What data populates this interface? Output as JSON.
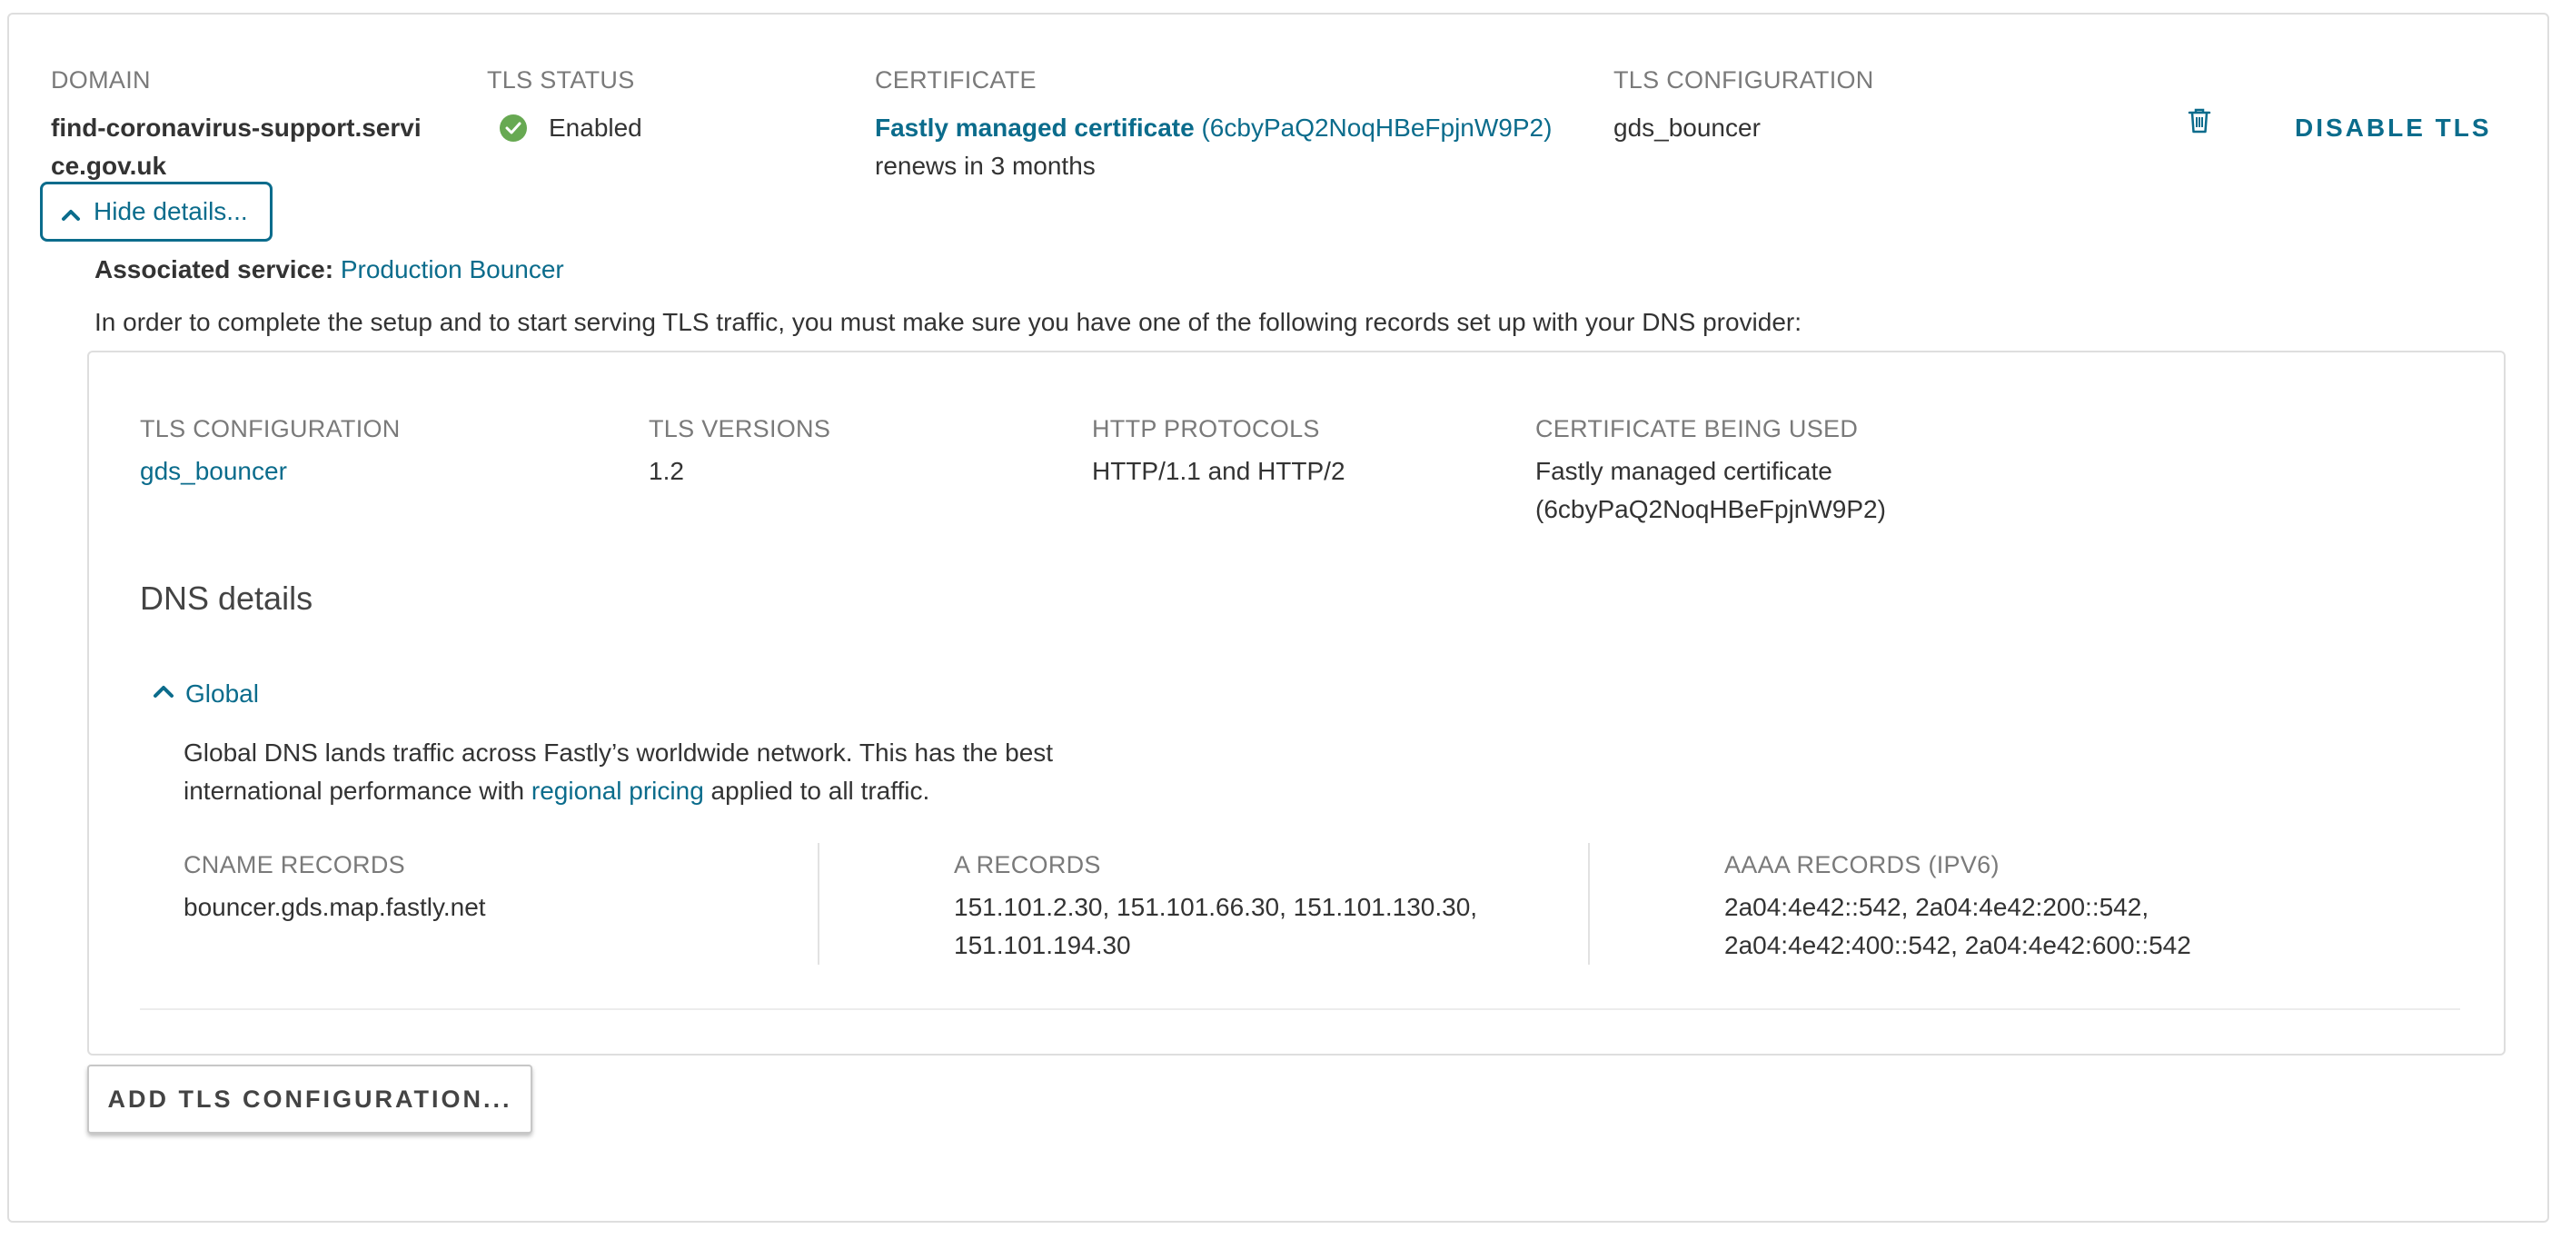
{
  "header": {
    "domain_label": "DOMAIN",
    "tls_status_label": "TLS STATUS",
    "certificate_label": "CERTIFICATE",
    "tls_config_label": "TLS CONFIGURATION"
  },
  "row": {
    "domain_line1": "find-coronavirus-support.servi",
    "domain_line2": "ce.gov.uk",
    "status": "Enabled",
    "certificate_name": "Fastly managed certificate",
    "certificate_id": "(6cbyPaQ2NoqHBeFpjnW9P2)",
    "renews": "renews in 3 months",
    "tls_config": "gds_bouncer",
    "disable_label": "DISABLE TLS",
    "icons": {
      "status": "check-circle-icon",
      "delete": "trash-icon"
    },
    "status_color": "#67a952"
  },
  "details": {
    "toggle_label": "Hide details...",
    "associated_label": "Associated service:",
    "associated_value": "Production Bouncer",
    "instructions": "In order to complete the setup and to start serving TLS traffic, you must make sure you have one of the following records set up with your DNS provider:"
  },
  "config": {
    "headers": {
      "tls_config": "TLS CONFIGURATION",
      "tls_versions": "TLS VERSIONS",
      "http_protocols": "HTTP PROTOCOLS",
      "certificate": "CERTIFICATE BEING USED"
    },
    "tls_config": "gds_bouncer",
    "tls_versions": "1.2",
    "http_protocols": "HTTP/1.1 and HTTP/2",
    "certificate_line1": "Fastly managed certificate",
    "certificate_line2": "(6cbyPaQ2NoqHBeFpjnW9P2)"
  },
  "dns": {
    "title": "DNS details",
    "region": "Global",
    "desc_line1": "Global DNS lands traffic across Fastly’s worldwide network. This has the best",
    "desc_line2_pre": "international performance with ",
    "desc_link": "regional pricing",
    "desc_line2_post": " applied to all traffic.",
    "cname_label": "CNAME RECORDS",
    "cname_value": "bouncer.gds.map.fastly.net",
    "a_label": "A RECORDS",
    "a_line1": "151.101.2.30, 151.101.66.30, 151.101.130.30,",
    "a_line2": "151.101.194.30",
    "aaaa_label": "AAAA RECORDS (IPV6)",
    "aaaa_line1": "2a04:4e42::542, 2a04:4e42:200::542,",
    "aaaa_line2": "2a04:4e42:400::542, 2a04:4e42:600::542"
  },
  "actions": {
    "add_tls": "ADD TLS CONFIGURATION..."
  },
  "colors": {
    "accent": "#0b6c8c",
    "muted": "#7a7a7a",
    "border": "#dedede"
  }
}
